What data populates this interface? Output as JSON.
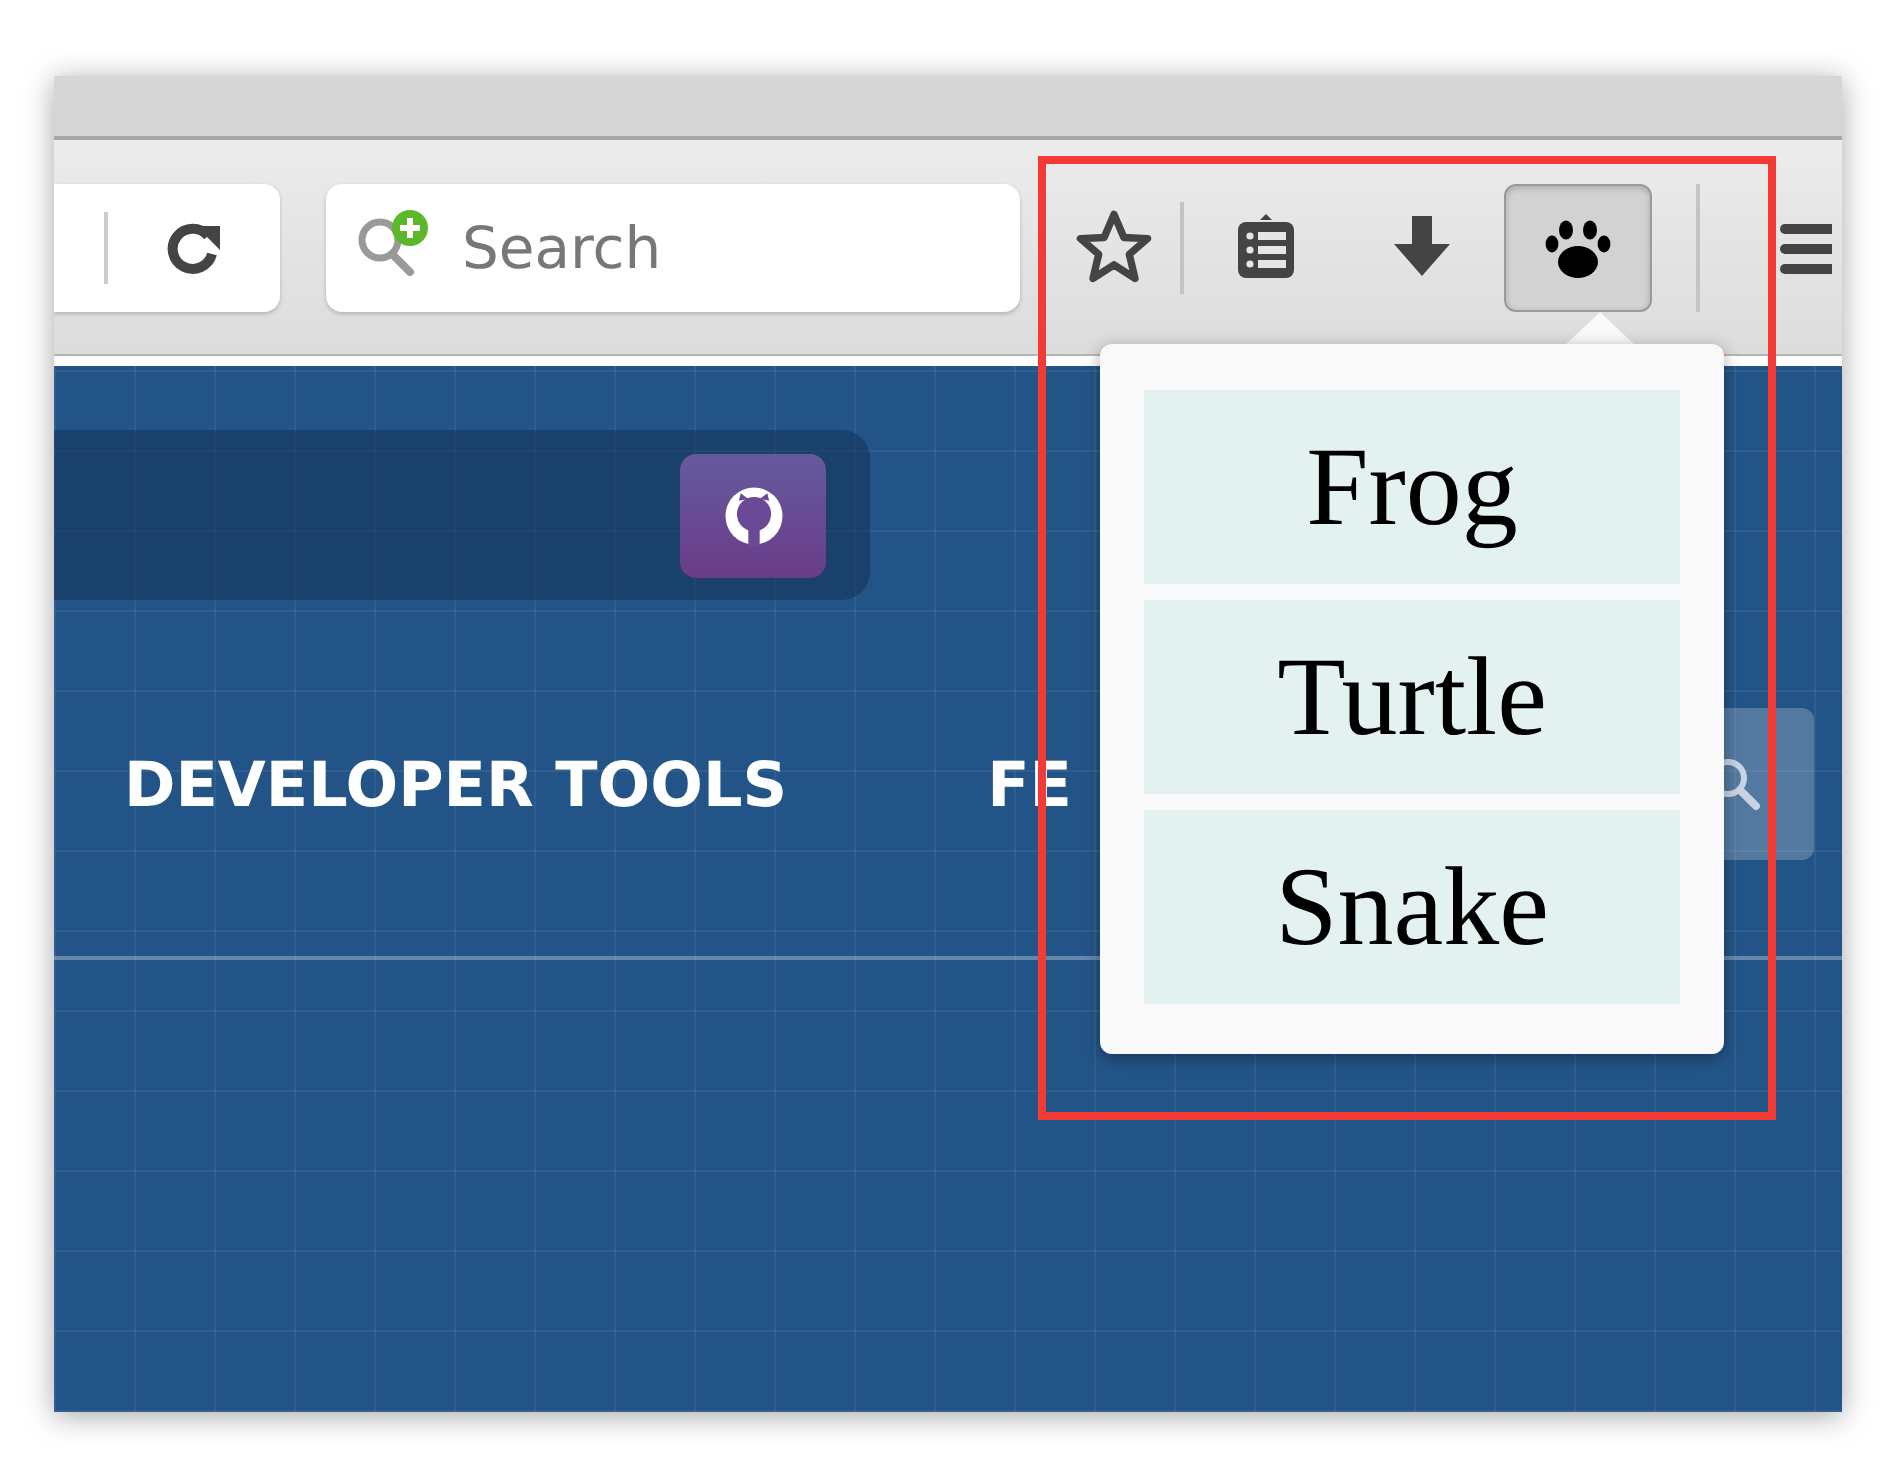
{
  "toolbar": {
    "search": {
      "placeholder": "Search"
    },
    "buttons": [
      {
        "kind": "star",
        "selected": false
      },
      {
        "kind": "clipboard",
        "selected": false
      },
      {
        "kind": "download",
        "selected": false
      },
      {
        "kind": "paw",
        "selected": true
      }
    ]
  },
  "page": {
    "nav": [
      "DEVELOPER TOOLS",
      "FE"
    ]
  },
  "popup": {
    "items": [
      "Frog",
      "Turtle",
      "Snake"
    ]
  }
}
